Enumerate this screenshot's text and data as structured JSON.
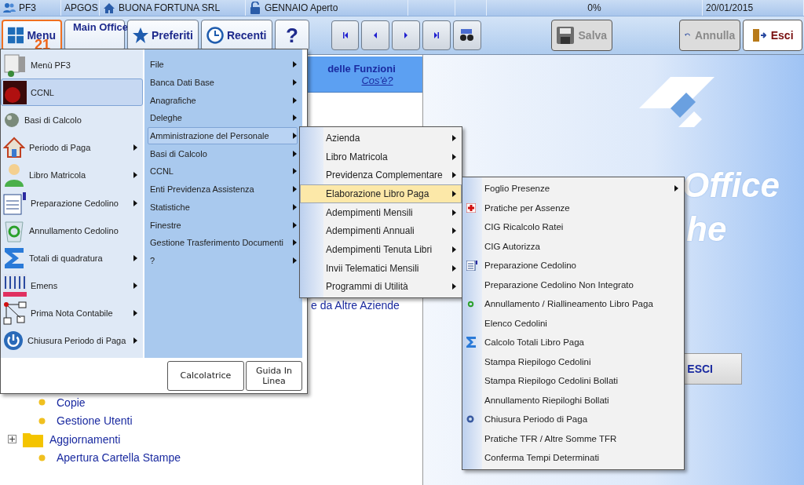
{
  "status_bar": [
    {
      "kind": "user",
      "text": "PF3"
    },
    {
      "kind": "plain",
      "text": "APGOS"
    },
    {
      "kind": "home",
      "text": "BUONA FORTUNA SRL"
    },
    {
      "kind": "lock",
      "text": "GENNAIO Aperto"
    },
    {
      "kind": "blank"
    },
    {
      "kind": "blank"
    },
    {
      "kind": "center",
      "text": "0%"
    },
    {
      "kind": "plain",
      "text": "20/01/2015"
    }
  ],
  "toolbar": {
    "menu": {
      "label": "Menu",
      "badge": "21",
      "selected": true
    },
    "buttons": [
      {
        "kind": "back",
        "label": "Main Office"
      },
      {
        "kind": "star",
        "label": "Preferiti"
      },
      {
        "kind": "clock",
        "label": "Recenti"
      },
      {
        "kind": "help",
        "label": "?"
      }
    ],
    "nav": [
      {
        "kind": "first"
      },
      {
        "kind": "prev"
      },
      {
        "kind": "next"
      },
      {
        "kind": "last"
      },
      {
        "kind": "find"
      }
    ],
    "actions": [
      {
        "kind": "save",
        "label": "Salva",
        "disabled": true
      },
      {
        "kind": "undo",
        "label": "Annulla",
        "disabled": true
      },
      {
        "kind": "exit",
        "label": "Esci",
        "disabled": false
      }
    ]
  },
  "functions_panel": {
    "title": "delle Funzioni",
    "link": "Cos'è?",
    "partial_text": "e da Altre Aziende",
    "tree": [
      {
        "kind": "leaf",
        "label": "Copie"
      },
      {
        "kind": "leaf",
        "label": "Gestione Utenti"
      },
      {
        "kind": "folder",
        "label": "Aggiornamenti",
        "expanded": false
      },
      {
        "kind": "leaf",
        "label": "Apertura Cartella Stampe"
      }
    ]
  },
  "welcome_panel": {
    "title_lines": [
      "Office",
      "he"
    ],
    "exit_button": "ESCI"
  },
  "start_menu": {
    "items": [
      {
        "label": "Menù PF3",
        "submenu": false,
        "selected": false
      },
      {
        "label": "CCNL",
        "submenu": false,
        "selected": true
      },
      {
        "label": "Basi di Calcolo",
        "submenu": false,
        "selected": false
      },
      {
        "label": "Periodo di Paga",
        "submenu": true,
        "selected": false
      },
      {
        "label": "Libro Matricola",
        "submenu": true,
        "selected": false
      },
      {
        "label": "Preparazione Cedolino",
        "submenu": true,
        "selected": false
      },
      {
        "label": "Annullamento Cedolino",
        "submenu": false,
        "selected": false
      },
      {
        "label": "Totali di quadratura",
        "submenu": true,
        "selected": false
      },
      {
        "label": "Emens",
        "submenu": true,
        "selected": false
      },
      {
        "label": "Prima Nota Contabile",
        "submenu": true,
        "selected": false
      },
      {
        "label": "Chiusura Periodo di Paga",
        "submenu": true,
        "selected": false
      }
    ],
    "categories": [
      {
        "label": "File",
        "selected": false
      },
      {
        "label": "Banca Dati Base",
        "selected": false
      },
      {
        "label": "Anagrafiche",
        "selected": false
      },
      {
        "label": "Deleghe",
        "selected": false
      },
      {
        "label": "Amministrazione del Personale",
        "selected": true
      },
      {
        "label": "Basi di Calcolo",
        "selected": false
      },
      {
        "label": "CCNL",
        "selected": false
      },
      {
        "label": "Enti Previdenza Assistenza",
        "selected": false
      },
      {
        "label": "Statistiche",
        "selected": false
      },
      {
        "label": "Finestre",
        "selected": false
      },
      {
        "label": "Gestione Trasferimento Documenti",
        "selected": false
      },
      {
        "label": "?",
        "selected": false
      }
    ],
    "buttons": [
      "Calcolatrice",
      "Guida In Linea"
    ]
  },
  "submenu": [
    {
      "label": "Azienda",
      "selected": false
    },
    {
      "label": "Libro Matricola",
      "selected": false
    },
    {
      "label": "Previdenza Complementare",
      "selected": false
    },
    {
      "label": "Elaborazione Libro Paga",
      "selected": true
    },
    {
      "label": "Adempimenti Mensili",
      "selected": false
    },
    {
      "label": "Adempimenti Annuali",
      "selected": false
    },
    {
      "label": "Adempimenti Tenuta Libri",
      "selected": false
    },
    {
      "label": "Invii Telematici Mensili",
      "selected": false
    },
    {
      "label": "Programmi di Utilità",
      "selected": false
    }
  ],
  "payroll_menu": [
    {
      "label": "Foglio Presenze",
      "submenu": true
    },
    {
      "label": "Pratiche per Assenze",
      "submenu": false
    },
    {
      "label": "CIG Ricalcolo Ratei",
      "submenu": false
    },
    {
      "label": "CIG Autorizza",
      "submenu": false
    },
    {
      "label": "Preparazione Cedolino",
      "submenu": false
    },
    {
      "label": "Preparazione Cedolino Non Integrato",
      "submenu": false
    },
    {
      "label": "Annullamento / Riallineamento Libro Paga",
      "submenu": false
    },
    {
      "label": "Elenco Cedolini",
      "submenu": false
    },
    {
      "label": "Calcolo Totali Libro Paga",
      "submenu": false
    },
    {
      "label": "Stampa Riepilogo Cedolini",
      "submenu": false
    },
    {
      "label": "Stampa Riepilogo Cedolini Bollati",
      "submenu": false
    },
    {
      "label": "Annullamento Riepiloghi Bollati",
      "submenu": false
    },
    {
      "label": "Chiusura Periodo di Paga",
      "submenu": false
    },
    {
      "label": "Pratiche TFR / Altre Somme TFR",
      "submenu": false
    },
    {
      "label": "Conferma Tempi Determinati",
      "submenu": false
    }
  ]
}
